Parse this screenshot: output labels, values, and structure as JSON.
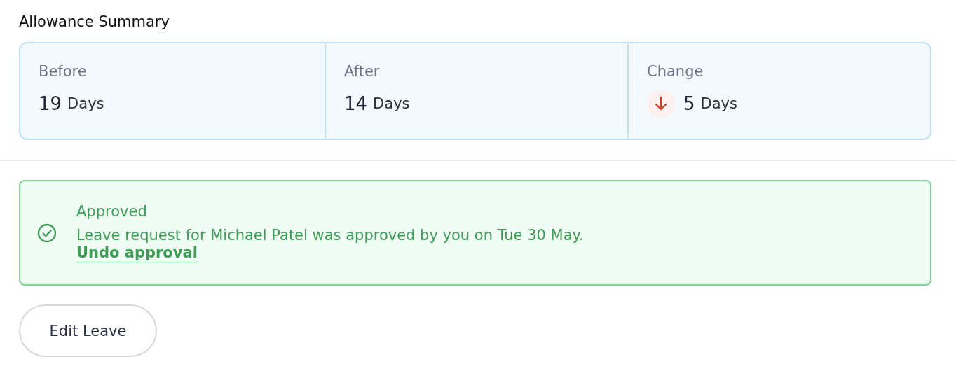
{
  "section_title": "Allowance Summary",
  "summary": [
    {
      "kind": "plain",
      "label": "Before",
      "value": "19",
      "unit": "Days"
    },
    {
      "kind": "plain",
      "label": "After",
      "value": "14",
      "unit": "Days"
    },
    {
      "kind": "decrease",
      "label": "Change",
      "value": "5",
      "unit": "Days"
    }
  ],
  "alert": {
    "title": "Approved",
    "message": "Leave request for Michael Patel was approved by you on Tue 30 May.",
    "link": "Undo approval"
  },
  "buttons": [
    "Edit Leave"
  ]
}
